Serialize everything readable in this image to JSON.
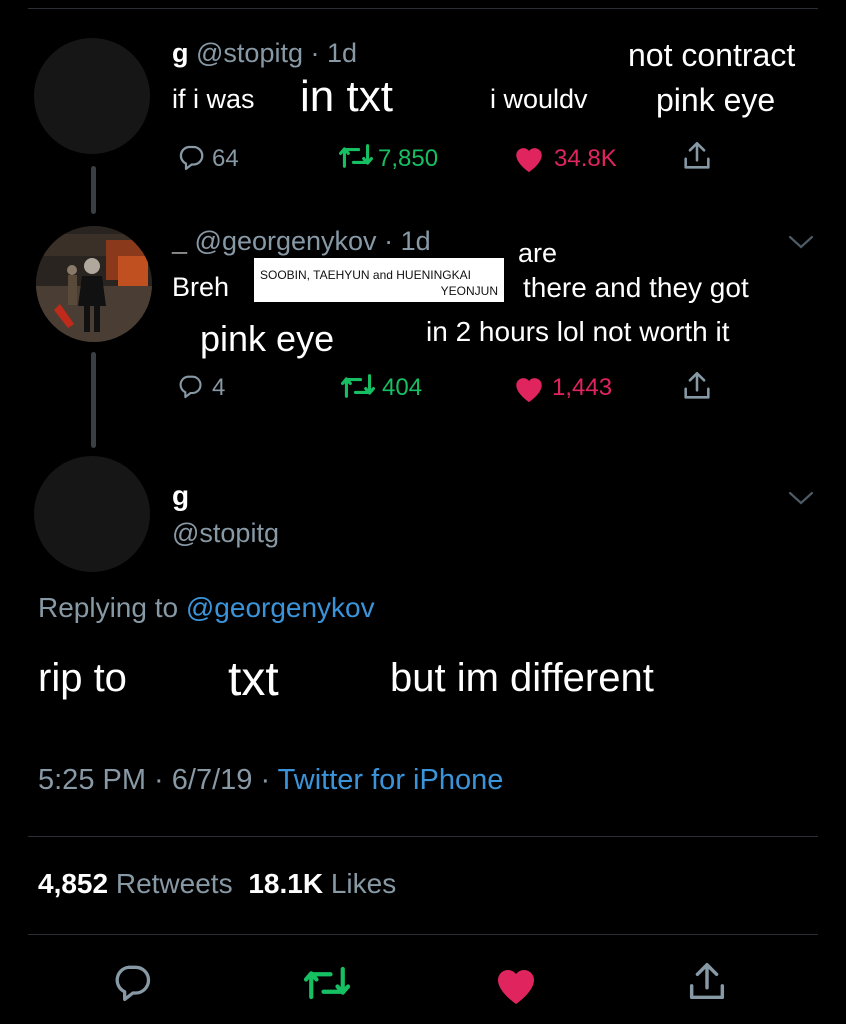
{
  "colors": {
    "background": "#000000",
    "secondary_text": "#8899a6",
    "retweet": "#17bf63",
    "like": "#e0245e",
    "link": "#3b94d9"
  },
  "tweet1": {
    "name": "g",
    "handle": "@stopitg",
    "time": "· 1d",
    "text_prefix": "if i was",
    "insert_txt": "in txt",
    "text_mid": "i wouldv",
    "insert_top": "not contract",
    "insert_bottom": "pink eye",
    "replies": "64",
    "retweets": "7,850",
    "likes": "34.8K"
  },
  "tweet2": {
    "name": "_",
    "handle": "@georgenykov",
    "time": "· 1d",
    "text_start": "Breh",
    "box_line1": "SOOBIN, TAEHYUN and HUENINGKAI",
    "box_line2": "YEONJUN",
    "insert_are": "are",
    "text_line1_end": "there and they got",
    "insert_pink": "pink eye",
    "text_line2_end": "in 2 hours lol not worth it",
    "replies": "4",
    "retweets": "404",
    "likes": "1,443"
  },
  "main_tweet": {
    "name": "g",
    "handle": "@stopitg",
    "replying_label": "Replying to",
    "replying_handle": "@georgenykov",
    "text_start": "rip to",
    "insert_txt": "txt",
    "text_end": "but im different",
    "time": "5:25 PM · 6/7/19 ·",
    "source": "Twitter for iPhone",
    "retweet_count": "4,852",
    "retweet_label": "Retweets",
    "like_count": "18.1K",
    "like_label": "Likes"
  },
  "icons": [
    "reply-icon",
    "retweet-icon",
    "like-icon",
    "share-icon",
    "chevron-down-icon"
  ]
}
